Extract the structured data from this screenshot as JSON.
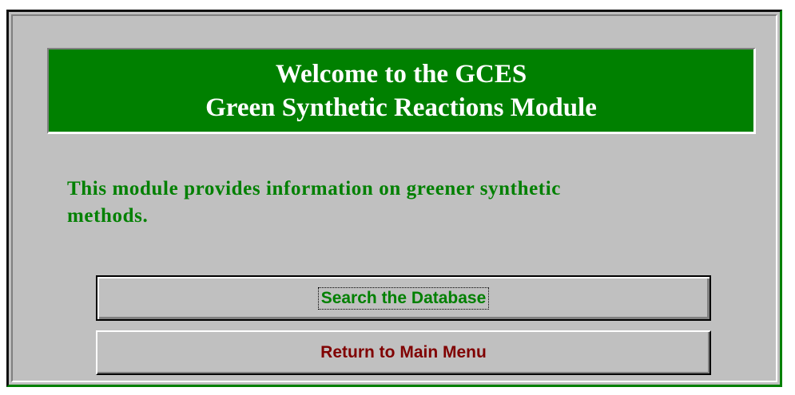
{
  "banner": {
    "line1": "Welcome to the GCES",
    "line2": "Green Synthetic Reactions Module"
  },
  "description": {
    "line1": "This module provides information on greener synthetic",
    "line2": "methods."
  },
  "buttons": {
    "search_label": "Search the Database",
    "return_label": "Return to Main Menu"
  },
  "colors": {
    "banner_bg": "#008000",
    "banner_text": "#ffffff",
    "description_text": "#008000",
    "search_text": "#008000",
    "return_text": "#800000",
    "window_bg": "#c0c0c0"
  }
}
